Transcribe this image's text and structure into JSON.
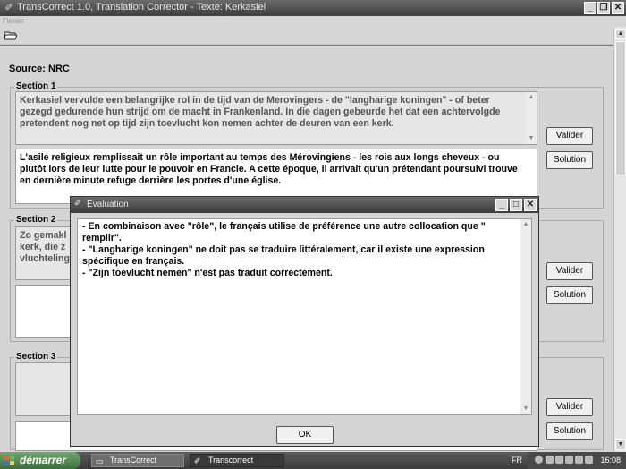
{
  "window": {
    "title": "TransCorrect 1.0, Translation Corrector - Texte: Kerkasiel"
  },
  "menu": {
    "file": "Fichier"
  },
  "source_label": "Source: NRC",
  "sections": [
    {
      "label": "Section 1",
      "source_text": "Kerkasiel vervulde een belangrijke rol in de tijd van de Merovingers - de \"langharige koningen\" - of beter gezegd gedurende hun strijd om de macht in Frankenland. In die dagen gebeurde het dat een achtervolgde pretendent nog net op tijd zijn toevlucht kon nemen achter de deuren van een kerk.",
      "translation_text": "L'asile religieux remplissait un rôle important au temps des Mérovingiens - les rois aux longs cheveux - ou plutôt lors de leur lutte pour le pouvoir en Francie. A cette époque, il arrivait qu'un prétendant poursuivi trouve en dernière minute refuge derrière les portes d'une église."
    },
    {
      "label": "Section 2",
      "source_text": "Zo gemakl\nkerk, die z\nvluchteling",
      "translation_text": ""
    },
    {
      "label": "Section 3",
      "source_text": "",
      "translation_text": ""
    }
  ],
  "buttons": {
    "validate": "Valider",
    "solution": "Solution"
  },
  "dialog": {
    "title": "Evaluation",
    "lines": [
      "- En combinaison avec \"rôle\", le français utilise de préférence une autre collocation  que \" remplir\".",
      "- \"Langharige koningen\" ne doit pas se traduire littéralement, car il existe une expression spécifique en français.",
      "- \"Zijn toevlucht nemen\" n'est pas traduit correctement."
    ],
    "ok": "OK"
  },
  "taskbar": {
    "start": "démarrer",
    "tasks": [
      "TransCorrect",
      "Transcorrect"
    ],
    "lang": "FR",
    "clock": "16:08"
  }
}
